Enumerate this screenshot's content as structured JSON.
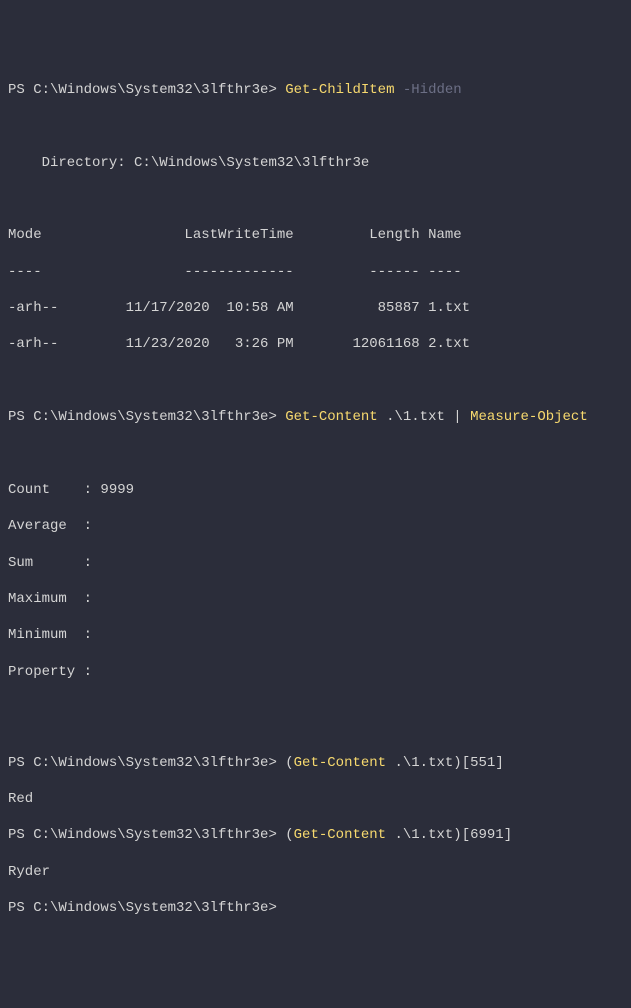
{
  "lines": {
    "l1_prompt": "PS C:\\Windows\\System32\\3lfthr3e> ",
    "l1_cmd": "Get-ChildItem",
    "l1_space": " ",
    "l1_param": "-Hidden",
    "blank1": "",
    "blank2": "",
    "dir_header": "    Directory: C:\\Windows\\System32\\3lfthr3e",
    "blank3": "",
    "blank4": "",
    "table_header": "Mode                 LastWriteTime         Length Name",
    "table_divider": "----                 -------------         ------ ----",
    "row1": "-arh--        11/17/2020  10:58 AM          85887 1.txt",
    "row2": "-arh--        11/23/2020   3:26 PM       12061168 2.txt",
    "blank5": "",
    "blank6": "",
    "l2_prompt": "PS C:\\Windows\\System32\\3lfthr3e> ",
    "l2_cmd1": "Get-Content",
    "l2_arg1": " .\\1.txt ",
    "l2_pipe": "|",
    "l2_space": " ",
    "l2_cmd2": "Measure-Object",
    "blank7": "",
    "blank8": "",
    "m_count": "Count    : 9999",
    "m_average": "Average  :",
    "m_sum": "Sum      :",
    "m_maximum": "Maximum  :",
    "m_minimum": "Minimum  :",
    "m_property": "Property :",
    "blank9": "",
    "blank10": "",
    "blank11": "",
    "l3_prompt": "PS C:\\Windows\\System32\\3lfthr3e> ",
    "l3_open": "(",
    "l3_cmd": "Get-Content",
    "l3_arg": " .\\1.txt)[",
    "l3_idx": "551",
    "l3_close": "]",
    "l3_out": "Red",
    "l4_prompt": "PS C:\\Windows\\System32\\3lfthr3e> ",
    "l4_open": "(",
    "l4_cmd": "Get-Content",
    "l4_arg": " .\\1.txt)[",
    "l4_idx": "6991",
    "l4_close": "]",
    "l4_out": "Ryder",
    "l5_prompt": "PS C:\\Windows\\System32\\3lfthr3e>"
  }
}
